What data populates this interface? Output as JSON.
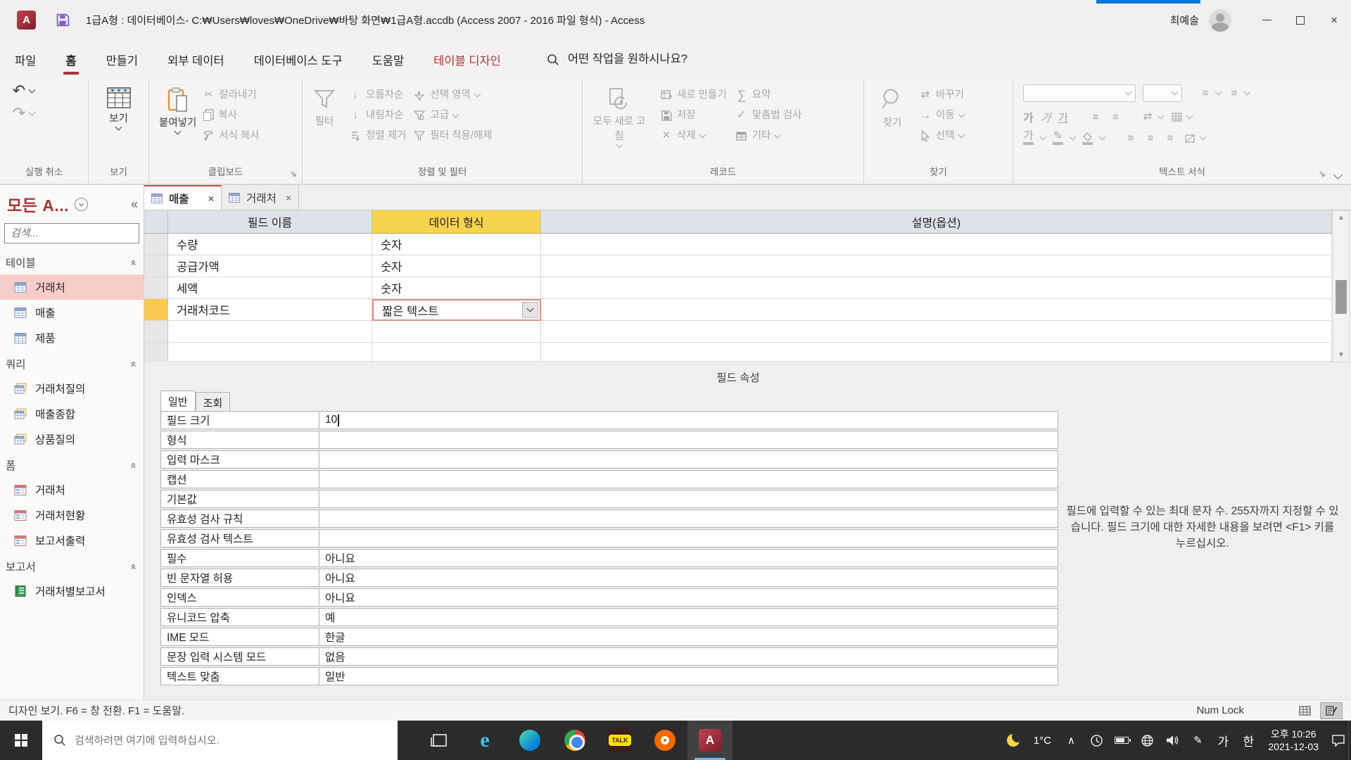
{
  "colors": {
    "brand_red": "#a4373a",
    "selection_yellow": "#f6d44e",
    "accent_blue": "#0078d7",
    "nav_selected_pink": "#f7cdc9"
  },
  "icons": {
    "undo": "↶",
    "redo": "↷",
    "cut": "✂",
    "delete": "×",
    "sum": "∑",
    "check": "✓",
    "arrow_right": "→",
    "swap": "⇄",
    "launcher": "⇘",
    "close": "×",
    "list": "≡",
    "up_arrow": "▲",
    "down_arrow": "▼",
    "collapse_left": "«",
    "sort_down": "↓",
    "pen": "✎",
    "chevron_up": "∧",
    "ga": "가"
  },
  "titlebar": {
    "title": "1급A형 : 데이터베이스- C:₩Users₩loves₩OneDrive₩바탕 화면₩1급A형.accdb (Access 2007 - 2016 파일 형식)  -  Access",
    "app_initial": "A",
    "user_name": "최예솔"
  },
  "menubar": {
    "tabs": [
      {
        "label": "파일"
      },
      {
        "label": "홈"
      },
      {
        "label": "만들기"
      },
      {
        "label": "외부 데이터"
      },
      {
        "label": "데이터베이스 도구"
      },
      {
        "label": "도움말"
      },
      {
        "label": "테이블 디자인"
      }
    ],
    "search_placeholder": "어떤 작업을 원하시나요?"
  },
  "ribbon": {
    "undo_group": {
      "label": "실행 취소"
    },
    "view_group": {
      "label": "보기",
      "view_button": "보기"
    },
    "clipboard_group": {
      "label": "클립보드",
      "paste": "붙여넣기",
      "cut": "잘라내기",
      "copy": "복사",
      "format_painter": "서식 복사"
    },
    "sort_group": {
      "label": "정렬 및 필터",
      "filter": "필터",
      "ascending": "오름차순",
      "descending": "내림차순",
      "remove_sort": "정렬 제거",
      "selection": "선택 영역",
      "advanced": "고급",
      "toggle_filter": "필터 적용/해제"
    },
    "records_group": {
      "label": "레코드",
      "refresh_all": "모두 새로 고침",
      "new": "새로 만들기",
      "save": "저장",
      "delete": "삭제",
      "totals": "요약",
      "spelling": "맞춤법 검사",
      "more": "기타"
    },
    "find_group": {
      "label": "찾기",
      "find": "찾기",
      "replace": "바꾸기",
      "goto": "이동",
      "select": "선택"
    },
    "text_group": {
      "label": "텍스트 서식"
    }
  },
  "nav": {
    "title": "모든 A...",
    "search_placeholder": "검색...",
    "groups": [
      {
        "label": "테이블",
        "items": [
          {
            "label": "거래처"
          },
          {
            "label": "매출"
          },
          {
            "label": "제품"
          }
        ]
      },
      {
        "label": "쿼리",
        "items": [
          {
            "label": "거래처질의"
          },
          {
            "label": "매출종합"
          },
          {
            "label": "상품질의"
          }
        ]
      },
      {
        "label": "폼",
        "items": [
          {
            "label": "거래처"
          },
          {
            "label": "거래처현황"
          },
          {
            "label": "보고서출력"
          }
        ]
      },
      {
        "label": "보고서",
        "items": [
          {
            "label": "거래처별보고서"
          }
        ]
      }
    ]
  },
  "document": {
    "tabs": [
      {
        "label": "매출"
      },
      {
        "label": "거래처"
      }
    ],
    "grid": {
      "columns": [
        "필드 이름",
        "데이터 형식",
        "설명(옵션)"
      ],
      "rows": [
        {
          "name": "수량",
          "type": "숫자",
          "desc": ""
        },
        {
          "name": "공급가액",
          "type": "숫자",
          "desc": ""
        },
        {
          "name": "세액",
          "type": "숫자",
          "desc": ""
        },
        {
          "name": "거래처코드",
          "type": "짧은 텍스트",
          "desc": ""
        }
      ]
    },
    "field_properties_caption": "필드 속성",
    "property_tabs": [
      {
        "label": "일반"
      },
      {
        "label": "조회"
      }
    ],
    "properties": [
      {
        "label": "필드 크기",
        "value": "10"
      },
      {
        "label": "형식",
        "value": ""
      },
      {
        "label": "입력 마스크",
        "value": ""
      },
      {
        "label": "캡션",
        "value": ""
      },
      {
        "label": "기본값",
        "value": ""
      },
      {
        "label": "유효성 검사 규칙",
        "value": ""
      },
      {
        "label": "유효성 검사 텍스트",
        "value": ""
      },
      {
        "label": "필수",
        "value": "아니요"
      },
      {
        "label": "빈 문자열 허용",
        "value": "아니요"
      },
      {
        "label": "인덱스",
        "value": "아니요"
      },
      {
        "label": "유니코드 압축",
        "value": "예"
      },
      {
        "label": "IME 모드",
        "value": "한글"
      },
      {
        "label": "문장 입력 시스템 모드",
        "value": "없음"
      },
      {
        "label": "텍스트 맞춤",
        "value": "일반"
      }
    ],
    "help_text": "필드에 입력할 수 있는 최대 문자 수. 255자까지 지정할 수 있습니다. 필드 크기에 대한 자세한 내용을 보려면 <F1> 키를 누르십시오."
  },
  "statusbar": {
    "mode_text": "디자인 보기. F6 = 창 전환. F1 = 도움말.",
    "numlock": "Num Lock"
  },
  "taskbar": {
    "search_placeholder": "검색하려면 여기에 입력하십시오.",
    "temperature": "1°C",
    "kakaotalk": "TALK",
    "ime_a": "가",
    "ime_han": "한",
    "time": "오후 10:26",
    "date": "2021-12-03"
  }
}
